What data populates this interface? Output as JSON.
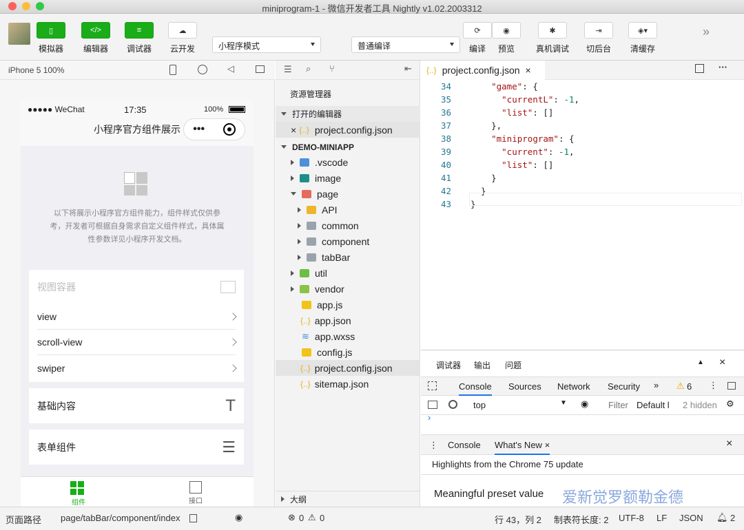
{
  "window": {
    "title": "miniprogram-1 - 微信开发者工具 Nightly v1.02.2003312"
  },
  "toolbar": {
    "simulator": "模拟器",
    "editor": "编辑器",
    "debugger": "调试器",
    "cloud": "云开发",
    "mode": "小程序模式",
    "compile_mode": "普通编译",
    "compile": "编译",
    "preview": "预览",
    "device_debug": "真机调试",
    "background": "切后台",
    "clear_cache": "清缓存"
  },
  "sim": {
    "device": "iPhone 5 100%",
    "carrier": "●●●●● WeChat",
    "time": "17:35",
    "battery": "100%",
    "nav_title": "小程序官方组件展示",
    "intro": "以下将展示小程序官方组件能力，组件样式仅供参考，开发者可根据自身需求自定义组件样式，具体属性参数详见小程序开发文档。",
    "section_header": "视图容器",
    "rows": [
      "view",
      "scroll-view",
      "swiper"
    ],
    "basic": "基础内容",
    "form": "表单组件",
    "tab1": "组件",
    "tab2": "接口"
  },
  "explorer": {
    "title": "资源管理器",
    "open_editors": "打开的编辑器",
    "open_file": "project.config.json",
    "project": "DEMO-MINIAPP",
    "outline": "大纲",
    "items": [
      ".vscode",
      "image",
      "page",
      "API",
      "common",
      "component",
      "tabBar",
      "util",
      "vendor",
      "app.js",
      "app.json",
      "app.wxss",
      "config.js",
      "project.config.json",
      "sitemap.json"
    ]
  },
  "editor": {
    "tab": "project.config.json",
    "lines": [
      {
        "n": "34",
        "t": "    \"game\": {"
      },
      {
        "n": "35",
        "t": "      \"currentL\": -1,"
      },
      {
        "n": "36",
        "t": "      \"list\": []"
      },
      {
        "n": "37",
        "t": "    },"
      },
      {
        "n": "38",
        "t": "    \"miniprogram\": {"
      },
      {
        "n": "39",
        "t": "      \"current\": -1,"
      },
      {
        "n": "40",
        "t": "      \"list\": []"
      },
      {
        "n": "41",
        "t": "    }"
      },
      {
        "n": "42",
        "t": "  }"
      },
      {
        "n": "43",
        "t": "}"
      }
    ]
  },
  "devtools": {
    "tabs": [
      "调试器",
      "输出",
      "问题"
    ],
    "panels": [
      "Console",
      "Sources",
      "Network",
      "Security"
    ],
    "warnings": "6",
    "context": "top",
    "filter": "Filter",
    "levels": "Default l",
    "hidden": "2 hidden",
    "drawer_console": "Console",
    "whats_new": "What's New",
    "highlights": "Highlights from the Chrome 75 update",
    "preset": "Meaningful preset value",
    "watermark": "爱新觉罗额勒金德"
  },
  "status": {
    "page_path_label": "页面路径",
    "page_path": "page/tabBar/component/index",
    "errors": "0",
    "warnings": "0",
    "position": "行 43，列 2",
    "tab_size": "制表符长度: 2",
    "encoding": "UTF-8",
    "eol": "LF",
    "lang": "JSON",
    "notifications": "2"
  }
}
